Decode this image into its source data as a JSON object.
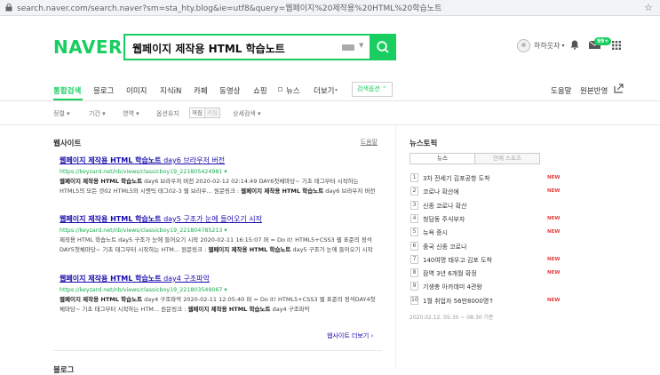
{
  "browser": {
    "url": "search.naver.com/search.naver?sm=sta_hty.blog&ie=utf8&query=웹페이지%20제작용%20HTML%20학습노트"
  },
  "header": {
    "logo": "NAVER",
    "query": "웹페이지 제작용 HTML 학습노트",
    "user_name": "하하웃자",
    "mail_badge": "99+"
  },
  "tabs": {
    "items": [
      "통합검색",
      "블로그",
      "이미지",
      "지식iN",
      "카페",
      "동영상",
      "쇼핑",
      "뉴스",
      "더보기"
    ],
    "search_options": "검색옵션",
    "help": "도움말",
    "original_exposure": "원본반영"
  },
  "filters": {
    "items": [
      "정렬",
      "기간",
      "영역",
      "옵션유지",
      "상세검색"
    ],
    "toggle_on": "꺼짐",
    "toggle_off": "켜짐"
  },
  "website": {
    "heading": "웹사이트",
    "help": "도움말",
    "results": [
      {
        "title_bold": "웹페이지 제작용 HTML 학습노트",
        "title_rest": " day6 브라우저 버전",
        "url": "https://keyzard.net/nb/views/classicboy19_221805424981",
        "desc_bold": "웹페이지 제작용 HTML 학습노트",
        "desc": " day6 브라우저 버전 2020-02-12 02:14:49 DAY6첫체마당~ 기초 태그부터 시작하는 HTML5의 모든 것02 HTML5와 시맨틱 태그02-3 웹 브라우... 원문링크 : ",
        "desc_bold2": "웹페이지 제작용 HTML 학습노트",
        "desc_tail": " day6 브라우저 버전"
      },
      {
        "title_bold": "웹페이지 제작용 HTML 학습노트",
        "title_rest": " day5 구조가 눈에 들어오기 시작",
        "url": "https://keyzard.net/nb/views/classicboy19_221804785213",
        "desc_bold": "",
        "desc": "제작용 HTML 학습노트 day5 구조가 눈에 들어오기 시작 2020-02-11 16:15:07 퍼 = Do it! HTML5+CSS3 웹 표준의 정석DAY5첫체마당~ 기초 태그부터 시작하는 HTM... 원문링크 : ",
        "desc_bold2": "웹페이지 제작용 HTML 학습노트",
        "desc_tail": " day5 구조가 눈에 들어오기 시작"
      },
      {
        "title_bold": "웹페이지 제작용 HTML 학습노트",
        "title_rest": " day4 구조파악",
        "url": "https://keyzard.net/nb/views/classicboy19_221803549067",
        "desc_bold": "웹페이지 제작용 HTML 학습노트",
        "desc": " day4 구조파악 2020-02-11 12:05:40 퍼 = Do it! HTML5+CSS3 웹 표준의 정석DAY4첫체마당~ 기초 태그부터 시작하는 HTM... 원문링크 : ",
        "desc_bold2": "웹페이지 제작용 HTML 학습노트",
        "desc_tail": " day4 구조파악"
      }
    ],
    "more": "웹사이트 더보기",
    "next_heading": "블로그"
  },
  "news_topic": {
    "heading": "뉴스토픽",
    "tabs": [
      "뉴스",
      "연예 스포츠"
    ],
    "items": [
      {
        "rank": "1",
        "text": "3차 전세기 김포공항 도착",
        "badge": "NEW"
      },
      {
        "rank": "2",
        "text": "코로나 확산에",
        "badge": "NEW"
      },
      {
        "rank": "3",
        "text": "신종 코로나 확산",
        "badge": ""
      },
      {
        "rank": "4",
        "text": "청담동 주식부자",
        "badge": "NEW"
      },
      {
        "rank": "5",
        "text": "뉴욕 증시",
        "badge": "NEW"
      },
      {
        "rank": "6",
        "text": "중국 신종 코로나",
        "badge": ""
      },
      {
        "rank": "7",
        "text": "140여명 태우고 김포 도착",
        "badge": "NEW"
      },
      {
        "rank": "8",
        "text": "잠역 3년 6개월 확정",
        "badge": "NEW"
      },
      {
        "rank": "9",
        "text": "기생충 아카데미 4관왕",
        "badge": ""
      },
      {
        "rank": "10",
        "text": "1월 취업자 56만8000명↑",
        "badge": "NEW"
      }
    ],
    "timestamp": "2020.02.12. 05:30 ~ 08:30 기준"
  },
  "colors": {
    "brand": "#19ce60",
    "link": "#1a0dab",
    "url": "#19ad50",
    "new": "#e53e3e"
  }
}
